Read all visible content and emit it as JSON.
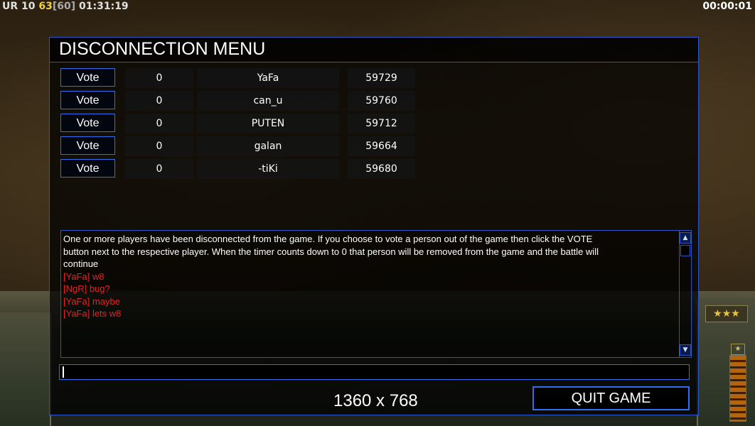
{
  "status": {
    "team": "UR",
    "value_a": "10",
    "value_b": "63",
    "value_c": "[60]",
    "clock": "01:31:19",
    "timer": "00:00:01"
  },
  "dialog": {
    "title": "DISCONNECTION MENU",
    "players": [
      {
        "vote_label": "Vote",
        "votes": "0",
        "name": "YaFa",
        "ping": "59729"
      },
      {
        "vote_label": "Vote",
        "votes": "0",
        "name": "can_u",
        "ping": "59760"
      },
      {
        "vote_label": "Vote",
        "votes": "0",
        "name": "PUTEN",
        "ping": "59712"
      },
      {
        "vote_label": "Vote",
        "votes": "0",
        "name": "galan",
        "ping": "59664"
      },
      {
        "vote_label": "Vote",
        "votes": "0",
        "name": "-tiKi",
        "ping": "59680"
      }
    ],
    "chat": {
      "info_lines": [
        "One or more players have been disconnected from the game. If you choose to vote a person out of the game then click the VOTE",
        " button next to the respective player. When the timer counts down to 0 that person will be removed from the game and the battle will",
        " continue"
      ],
      "messages": [
        "[YaFa] w8",
        "[NgR] bug?",
        "[YaFa] maybe",
        "[YaFa] lets w8"
      ]
    },
    "chat_input_value": "",
    "resolution": "1360 x 768",
    "quit_label": "QUIT GAME"
  },
  "hud": {
    "rank_icon": "star-icon",
    "rank_stars": "★★★"
  },
  "colors": {
    "accent_border": "#2a55c8",
    "chat_red": "#e52424",
    "status_yellow": "#f0d040"
  }
}
